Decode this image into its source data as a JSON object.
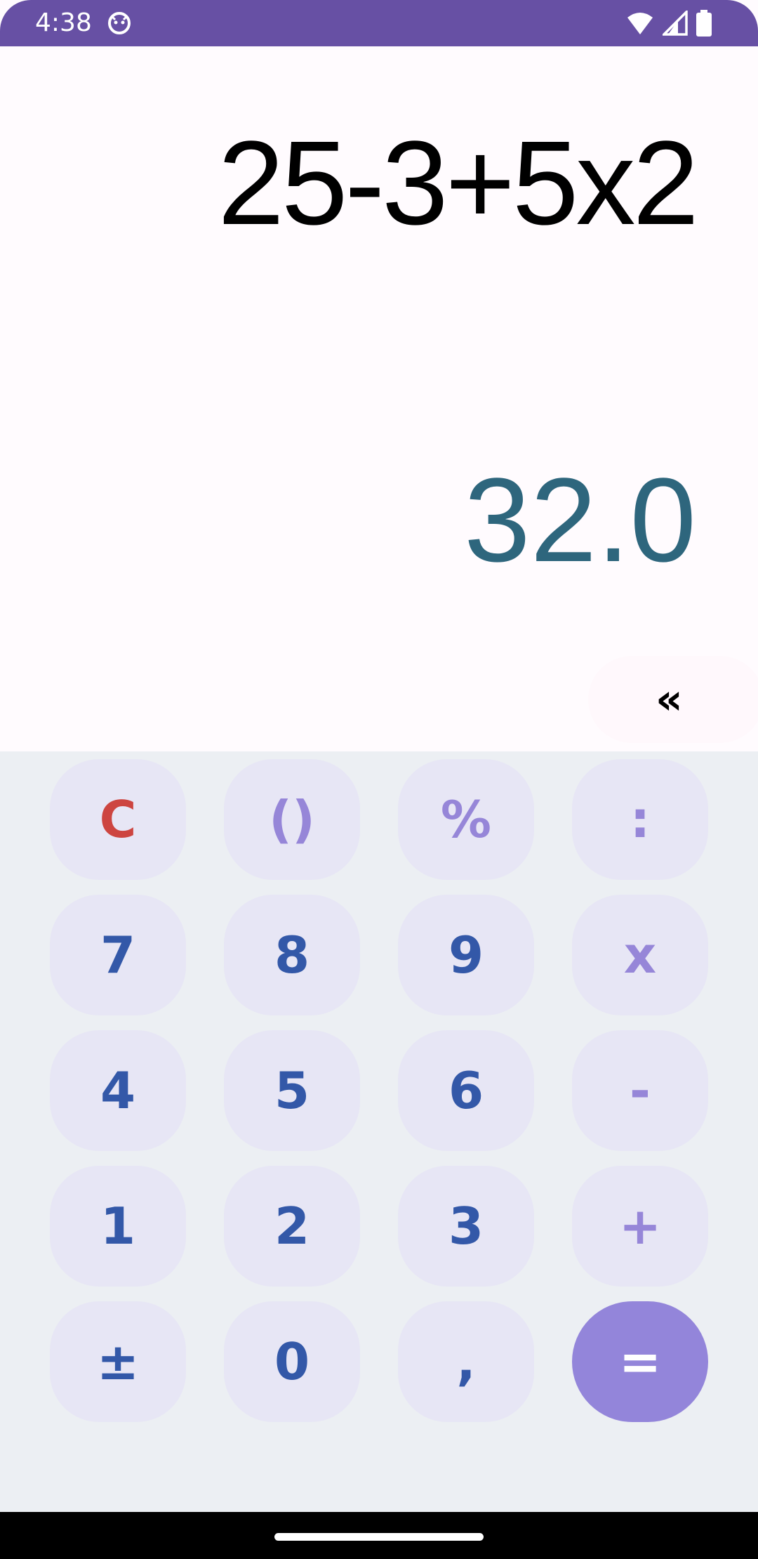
{
  "status_bar": {
    "time": "4:38",
    "color": "#6750a4",
    "icons": [
      "notification-face-icon",
      "wifi-icon",
      "signal-icon",
      "battery-icon"
    ]
  },
  "display": {
    "expression": "25-3+5x2",
    "result": "32.0",
    "result_color": "#2e667d",
    "backspace_label": "«"
  },
  "keypad": {
    "row1": {
      "clear": "C",
      "parens": "()",
      "percent": "%",
      "divide": ":"
    },
    "row2": {
      "seven": "7",
      "eight": "8",
      "nine": "9",
      "multiply": "x"
    },
    "row3": {
      "four": "4",
      "five": "5",
      "six": "6",
      "minus": "-"
    },
    "row4": {
      "one": "1",
      "two": "2",
      "three": "3",
      "plus": "+"
    },
    "row5": {
      "plusminus": "±",
      "zero": "0",
      "comma": ",",
      "equals": "="
    },
    "colors": {
      "digit": "#3358a8",
      "operator": "#9686d8",
      "clear": "#cd4540",
      "key_bg": "#e7e6f5",
      "equals_bg": "#9385da"
    }
  }
}
